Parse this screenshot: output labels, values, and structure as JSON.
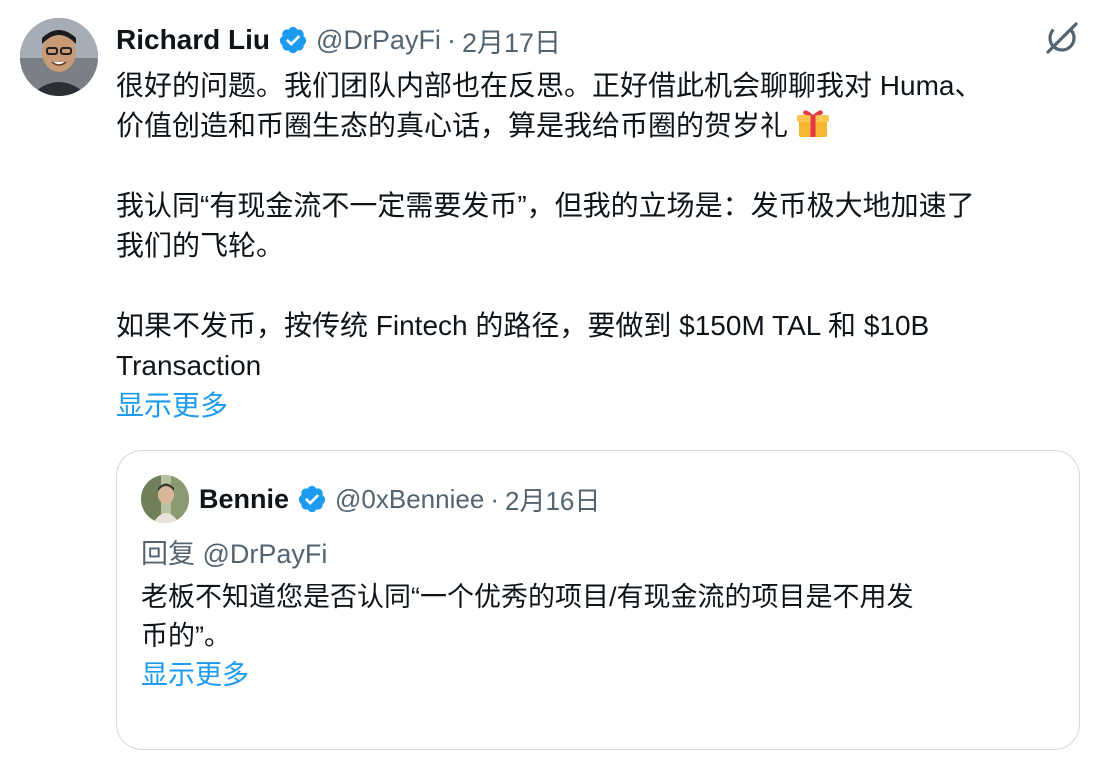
{
  "tweet": {
    "author": {
      "display_name": "Richard Liu",
      "handle": "@DrPayFi",
      "separator": "·",
      "date": "2月17日",
      "verified_icon": "verified-badge-icon"
    },
    "body": {
      "p1_line1": "很好的问题。我们团队内部也在反思。正好借此机会聊聊我对 Huma、",
      "p1_line2": "价值创造和币圈生态的真心话，算是我给币圈的贺岁礼",
      "p1_emoji": "gift-icon",
      "p2_line1": "我认同“有现金流不一定需要发币”，但我的立场是：发币极大地加速了",
      "p2_line2": "我们的飞轮。",
      "p3_line1": "如果不发币，按传统 Fintech 的路径，要做到 $150M TAL 和 $10B",
      "p3_line2": "Transaction"
    },
    "show_more": "显示更多",
    "grok_icon": "grok-icon"
  },
  "quote": {
    "author": {
      "display_name": "Bennie",
      "handle": "@0xBenniee",
      "separator": "·",
      "date": "2月16日"
    },
    "reply_to": "回复 @DrPayFi",
    "text_line1": "老板不知道您是否认同“一个优秀的项目/有现金流的项目是不用发",
    "text_line2": "币的”。",
    "show_more": "显示更多"
  },
  "colors": {
    "link": "#1d9bf0",
    "secondary_text": "#536471",
    "primary_text": "#0f1419",
    "border": "#cfd9de",
    "verified": "#1d9bf0"
  }
}
